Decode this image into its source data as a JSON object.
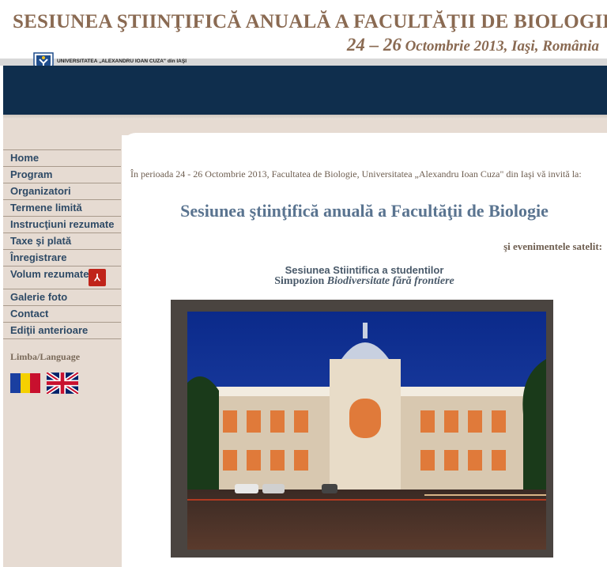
{
  "header": {
    "title": "SESIUNEA ŞTIINŢIFICĂ ANUALĂ A FACULTĂŢII DE BIOLOGIE",
    "dates_num": "24 – 26",
    "dates_text": " Octombrie 2013, Iaşi, România",
    "university": "UNIVERSITATEA „ALEXANDRU IOAN CUZA\" din IAŞI"
  },
  "nav": {
    "items": [
      "Home",
      "Program",
      "Organizatori",
      "Termene limită",
      "Instrucţiuni rezumate",
      "Taxe şi plată",
      "Înregistrare",
      "Volum rezumate",
      "Galerie foto",
      "Contact",
      "Ediţii anterioare"
    ],
    "pdf_icon": "pdf-icon"
  },
  "language": {
    "label": "Limba/Language"
  },
  "main": {
    "intro": "În perioada 24 - 26 Octombrie 2013, Facultatea de Biologie, Universitatea „Alexandru Ioan Cuza\" din Iaşi vă invită la:",
    "heading": "Sesiunea ştiinţifică anuală a Facultăţii de Biologie",
    "satellite": "şi evenimentele satelit:",
    "sub1": "Sesiunea Stiintifica a studentilor",
    "sub2_prefix": "Simpozion ",
    "sub2_italic": "Biodiversitate fără frontiere"
  },
  "colors": {
    "brand_blue": "#0f2e4d",
    "sidebar_bg": "#e6dbd2",
    "nav_text": "#2e4a66",
    "title_brown": "#8a6a52"
  }
}
